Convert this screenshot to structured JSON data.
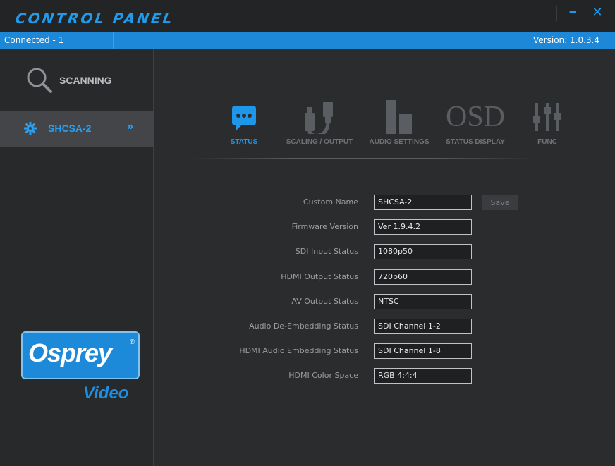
{
  "window": {
    "title": "CONTROL PANEL",
    "minimize_glyph": "−",
    "close_glyph": "✕"
  },
  "statusbar": {
    "connection": "Connected - 1",
    "version": "Version: 1.0.3.4"
  },
  "sidebar": {
    "scan_label": "SCANNING",
    "device_label": "SHCSA-2",
    "device_arrow": "»"
  },
  "logo": {
    "brand": "Osprey",
    "registered": "®",
    "sub": "Video"
  },
  "tabs": [
    {
      "label": "STATUS",
      "icon": "chat-bubble-icon",
      "active": true
    },
    {
      "label": "SCALING / OUTPUT",
      "icon": "cable-plug-icon",
      "active": false
    },
    {
      "label": "AUDIO SETTINGS",
      "icon": "bar-chart-icon",
      "active": false
    },
    {
      "label": "STATUS DISPLAY",
      "icon": "osd-text-icon",
      "osd_text": "OSD",
      "active": false
    },
    {
      "label": "FUNC",
      "icon": "sliders-icon",
      "active": false
    }
  ],
  "form": {
    "custom_name_label": "Custom Name",
    "custom_name_value": "SHCSA-2",
    "save_label": "Save",
    "firmware_label": "Firmware Version",
    "firmware_value": "Ver 1.9.4.2",
    "sdi_input_label": "SDI Input Status",
    "sdi_input_value": "1080p50",
    "hdmi_output_label": "HDMI Output Status",
    "hdmi_output_value": "720p60",
    "av_output_label": "AV Output Status",
    "av_output_value": "NTSC",
    "audio_deembed_label": "Audio De-Embedding Status",
    "audio_deembed_value": "SDI Channel 1-2",
    "hdmi_audio_embed_label": "HDMI Audio Embedding Status",
    "hdmi_audio_embed_value": "SDI Channel 1-8",
    "hdmi_color_label": "HDMI Color Space",
    "hdmi_color_value": "RGB 4:4:4"
  },
  "colors": {
    "accent": "#1e96ea",
    "background": "#2b2c2e",
    "sidebar": "#28292b",
    "statusbar": "#1e88d8",
    "inactive_icon": "#5a5d61"
  }
}
